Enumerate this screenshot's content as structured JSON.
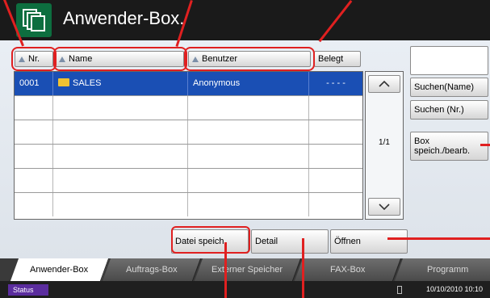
{
  "header": {
    "title": "Anwender-Box."
  },
  "columns": {
    "nr": "Nr.",
    "name": "Name",
    "user": "Benutzer",
    "used": "Belegt"
  },
  "rows": [
    {
      "nr": "0001",
      "name": "SALES",
      "user": "Anonymous",
      "used": "- - - -"
    }
  ],
  "scroll": {
    "page": "1/1"
  },
  "sidebar": {
    "search_name": "Suchen(Name)",
    "search_nr": "Suchen (Nr.)",
    "box_edit_line1": "Box",
    "box_edit_line2": "speich./bearb."
  },
  "actions": {
    "save_file": "Datei speich.",
    "detail": "Detail",
    "open": "Öffnen"
  },
  "tabs": [
    "Anwender-Box",
    "Auftrags-Box",
    "Externer Speicher",
    "FAX-Box",
    "Programm"
  ],
  "status": {
    "label": "Status",
    "datetime": "10/10/2010 10:10"
  },
  "colors": {
    "header": "#1a1a1a",
    "icon_bg": "#0d6e3f",
    "selected_row": "#1a4fb4",
    "highlight": "#e02020",
    "status_badge": "#5b2d9e"
  }
}
